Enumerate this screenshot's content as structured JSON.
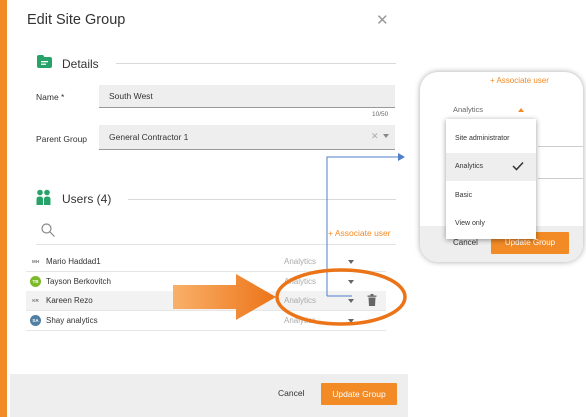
{
  "dialog": {
    "title": "Edit Site Group",
    "close_icon": "close-icon",
    "close_glyph": "✕"
  },
  "details": {
    "label": "Details",
    "icon": "folder-icon",
    "name_label": "Name *",
    "name_value": "South West",
    "name_counter": "10/50",
    "parent_label": "Parent Group",
    "parent_value": "General Contractor 1",
    "clear_glyph": "✕"
  },
  "users": {
    "label": "Users (4)",
    "icon": "users-icon",
    "associate_label": "+ Associate user",
    "rows": [
      {
        "initials": "MH",
        "name": "Mario Haddad1",
        "role": "Analytics"
      },
      {
        "initials": "TB",
        "name": "Tayson Berkovitch",
        "role": "Analytics"
      },
      {
        "initials": "KR",
        "name": "Kareen Rezo",
        "role": "Analytics"
      },
      {
        "initials": "SA",
        "name": "Shay analytics",
        "role": "Analytics"
      }
    ]
  },
  "footer": {
    "cancel_label": "Cancel",
    "update_label": "Update Group"
  },
  "zoom": {
    "associate_label": "+ Associate user",
    "selected_role": "Analytics",
    "cancel_label": "Cancel",
    "update_label": "Update Group",
    "options": [
      "Site administrator",
      "Analytics",
      "Basic",
      "View only"
    ],
    "selected_index": 1
  },
  "colors": {
    "accent": "#f28a25",
    "icon_green": "#27a36a",
    "callout_line": "#4f7fc8"
  }
}
